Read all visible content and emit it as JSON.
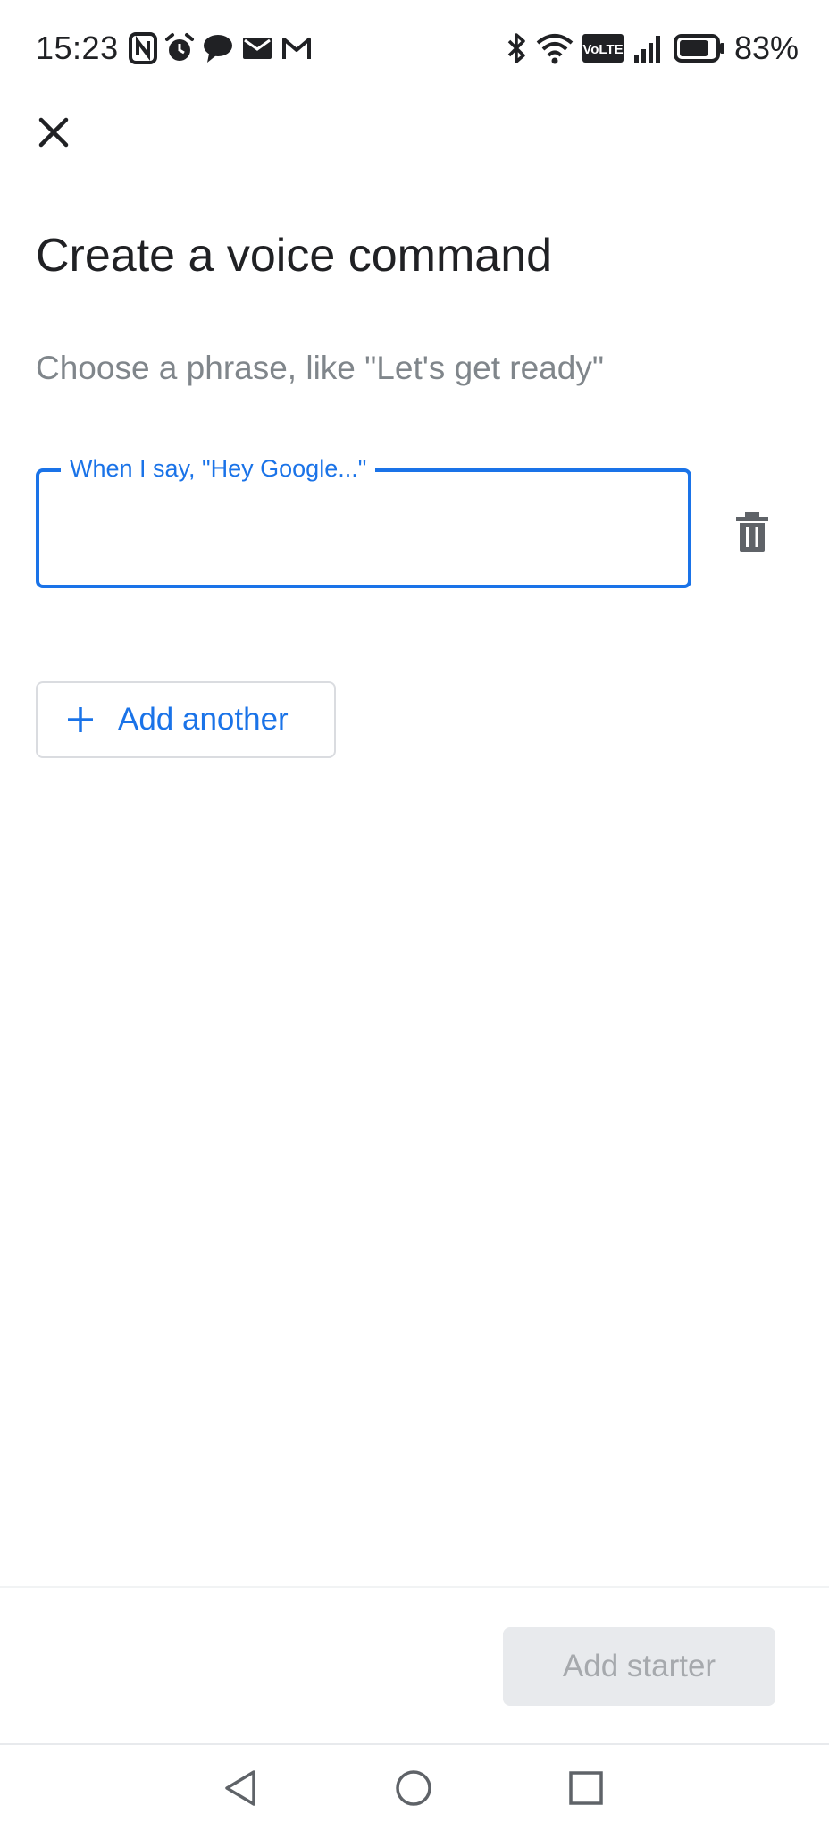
{
  "status_bar": {
    "time": "15:23",
    "battery_text": "83%",
    "left_icons": [
      "nfc-icon",
      "alarm-icon",
      "chat-bubble-icon",
      "mail-icon",
      "gmail-icon"
    ],
    "right_icons": [
      "bluetooth-icon",
      "wifi-icon",
      "volte-icon",
      "signal-icon",
      "battery-icon"
    ],
    "volte_label": "VoLTE",
    "battery_level": 0.83
  },
  "header": {
    "close_icon": "close-icon"
  },
  "main": {
    "title": "Create a voice command",
    "subtitle": "Choose a phrase, like \"Let's get ready\"",
    "phrase_field": {
      "label": "When I say, \"Hey Google...\"",
      "value": "",
      "placeholder": ""
    },
    "delete_icon": "trash-icon",
    "add_another_label": "Add another",
    "add_another_icon": "plus-icon"
  },
  "footer": {
    "add_starter_label": "Add starter"
  },
  "colors": {
    "accent": "#1a73e8",
    "text_primary": "#202124",
    "text_secondary": "#80868b",
    "disabled_button_bg": "#e8eaed",
    "disabled_button_text": "#a6a9ad"
  },
  "nav_bar": {
    "icons": [
      "back-triangle-icon",
      "home-circle-icon",
      "recents-square-icon"
    ]
  }
}
